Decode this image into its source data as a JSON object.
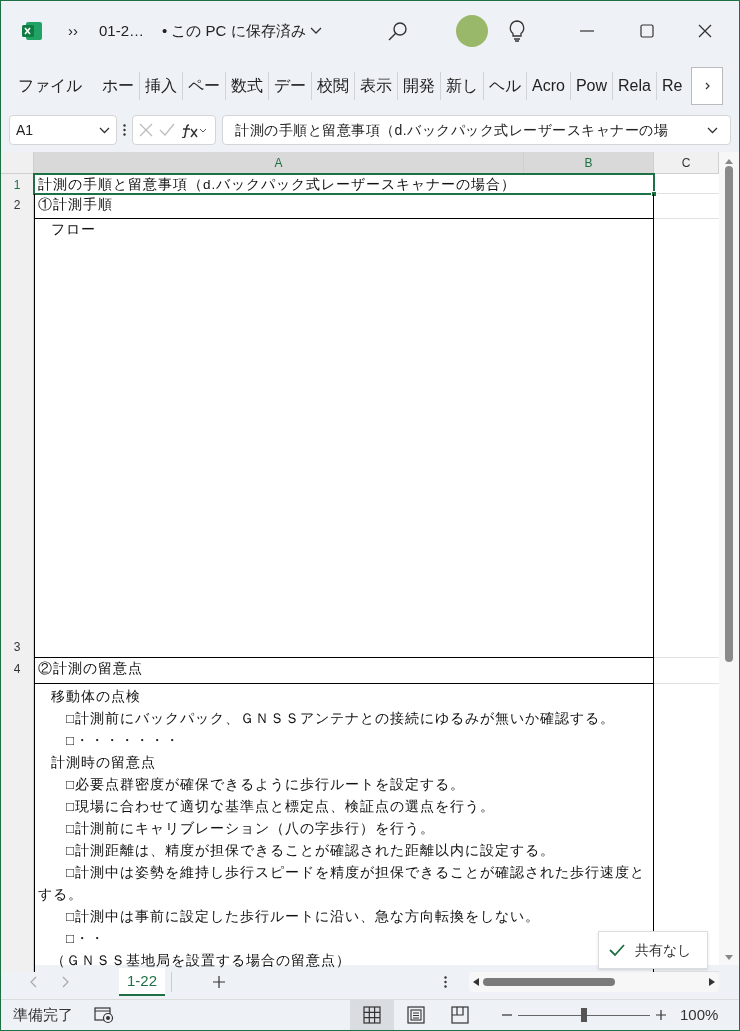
{
  "window": {
    "title": "01-2…",
    "save_status": "• この PC に保存済み",
    "overflow_button": "››"
  },
  "ribbon_tabs": [
    "ファイル",
    "ホー",
    "挿入",
    "ペー",
    "数式",
    "デー",
    "校閲",
    "表示",
    "開発",
    "新し",
    "ヘル",
    "Acro",
    "Pow",
    "Rela",
    "Re"
  ],
  "formula_bar": {
    "name_box": "A1",
    "formula": "計測の手順と留意事項（d.バックパック式レーザースキャナーの場"
  },
  "columns": [
    "A",
    "B",
    "C"
  ],
  "rows": [
    {
      "number": "1",
      "selected": true,
      "lines": [
        {
          "kind": "title",
          "text": "計測の手順と留意事項（d.バックパック式レーザースキャナーの場合）"
        }
      ]
    },
    {
      "number": "2",
      "selected": false,
      "lines": [
        {
          "kind": "title",
          "text": "①計測手順"
        }
      ]
    },
    {
      "number": "3",
      "selected": false,
      "lines": [
        {
          "kind": "heading",
          "text": "フロー"
        }
      ]
    },
    {
      "number": "4",
      "selected": false,
      "lines": [
        {
          "kind": "title",
          "text": "②計測の留意点"
        }
      ]
    },
    {
      "selected": false,
      "lines": [
        {
          "kind": "heading",
          "text": "移動体の点検"
        },
        {
          "kind": "item",
          "text": "□計測前にバックパック、ＧＮＳＳアンテナとの接続にゆるみが無いか確認する。"
        },
        {
          "kind": "item",
          "text": "□・・・・・・・"
        },
        {
          "kind": "heading",
          "text": "計測時の留意点"
        },
        {
          "kind": "item",
          "text": "□必要点群密度が確保できるように歩行ルートを設定する。"
        },
        {
          "kind": "item",
          "text": "□現場に合わせて適切な基準点と標定点、検証点の選点を行う。"
        },
        {
          "kind": "item",
          "text": "□計測前にキャリブレーション（八の字歩行）を行う。"
        },
        {
          "kind": "item",
          "text": "□計測距離は、精度が担保できることが確認された距離以内に設定する。"
        },
        {
          "kind": "item",
          "text": "□計測中は姿勢を維持し歩行スピードを精度が担保できることが確認された歩行速度とする。"
        },
        {
          "kind": "item",
          "text": "□計測中は事前に設定した歩行ルートに沿い、急な方向転換をしない。"
        },
        {
          "kind": "item",
          "text": "□・・"
        },
        {
          "kind": "heading",
          "text": "（ＧＮＳＳ基地局を設置する場合の留意点）"
        }
      ]
    }
  ],
  "share_popup": {
    "label": "共有なし"
  },
  "sheet_tabs": [
    {
      "label": "1-22",
      "selected": true
    }
  ],
  "status_bar": {
    "status": "準備完了",
    "views": [
      {
        "kind": "normal",
        "selected": true
      },
      {
        "kind": "page_layout",
        "selected": false
      },
      {
        "kind": "page_break",
        "selected": false
      }
    ],
    "zoom": {
      "level": 0.5,
      "reading": "100%"
    }
  }
}
